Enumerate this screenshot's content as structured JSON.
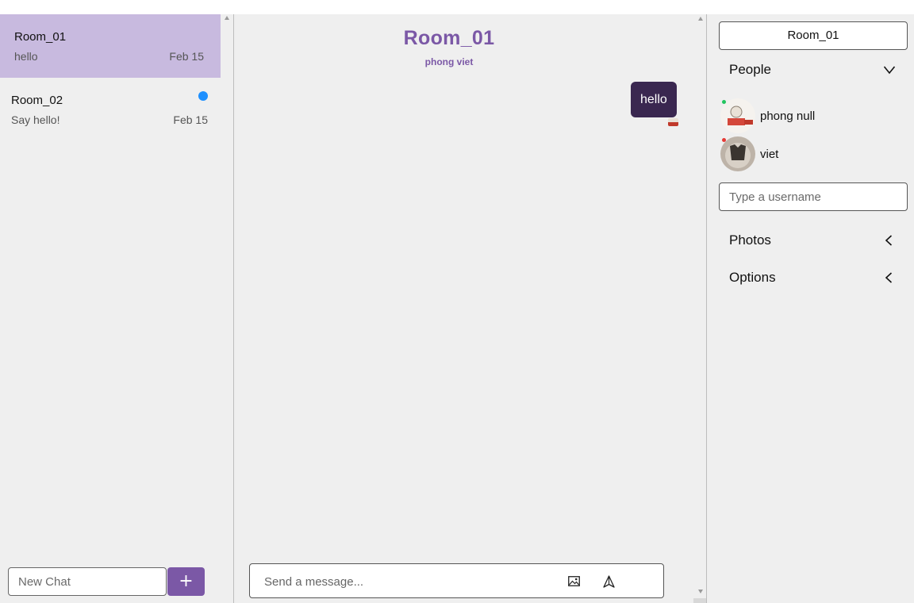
{
  "sidebar": {
    "rooms": [
      {
        "name": "Room_01",
        "preview": "hello",
        "date": "Feb 15",
        "active": true,
        "unread": false
      },
      {
        "name": "Room_02",
        "preview": "Say hello!",
        "date": "Feb 15",
        "active": false,
        "unread": true
      }
    ],
    "new_chat_placeholder": "New Chat",
    "add_label": "+"
  },
  "chat": {
    "title": "Room_01",
    "members": "phong viet",
    "messages": [
      {
        "text": "hello",
        "own": true
      }
    ],
    "composer_placeholder": "Send a message..."
  },
  "details": {
    "room_name": "Room_01",
    "people": {
      "title": "People",
      "expanded": true,
      "list": [
        {
          "name": "phong null",
          "status_color": "#22c55e"
        },
        {
          "name": "viet",
          "status_color": "#e53935"
        }
      ],
      "search_placeholder": "Type a username"
    },
    "photos": {
      "title": "Photos",
      "expanded": false
    },
    "options": {
      "title": "Options",
      "expanded": false
    }
  },
  "colors": {
    "accent": "#7b58a6",
    "active_room": "#c8badf",
    "bubble": "#3a2750",
    "unread_dot": "#1e90ff",
    "background": "#efefef"
  },
  "icons": [
    "plus-icon",
    "image-icon",
    "send-icon",
    "chevron-down-icon",
    "chevron-left-icon"
  ]
}
